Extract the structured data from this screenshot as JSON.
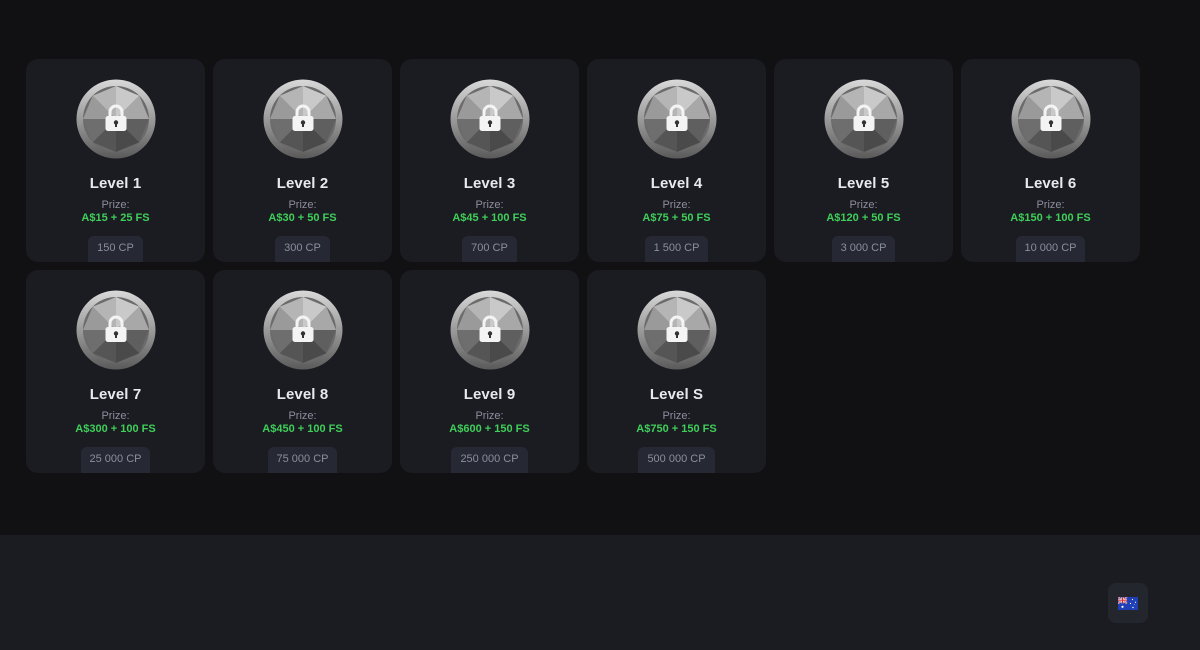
{
  "levels": [
    {
      "title": "Level 1",
      "prize_label": "Prize:",
      "prize": "A$15 + 25 FS",
      "points": "150 CP",
      "icon": "lock-icon"
    },
    {
      "title": "Level 2",
      "prize_label": "Prize:",
      "prize": "A$30 + 50 FS",
      "points": "300 CP",
      "icon": "lock-icon"
    },
    {
      "title": "Level 3",
      "prize_label": "Prize:",
      "prize": "A$45 + 100 FS",
      "points": "700 CP",
      "icon": "lock-icon"
    },
    {
      "title": "Level 4",
      "prize_label": "Prize:",
      "prize": "A$75 + 50 FS",
      "points": "1 500 CP",
      "icon": "lock-icon"
    },
    {
      "title": "Level 5",
      "prize_label": "Prize:",
      "prize": "A$120 + 50 FS",
      "points": "3 000 CP",
      "icon": "lock-icon"
    },
    {
      "title": "Level 6",
      "prize_label": "Prize:",
      "prize": "A$150 + 100 FS",
      "points": "10 000 CP",
      "icon": "lock-icon"
    },
    {
      "title": "Level 7",
      "prize_label": "Prize:",
      "prize": "A$300 + 100 FS",
      "points": "25 000 CP",
      "icon": "lock-icon"
    },
    {
      "title": "Level 8",
      "prize_label": "Prize:",
      "prize": "A$450 + 100 FS",
      "points": "75 000 CP",
      "icon": "lock-icon"
    },
    {
      "title": "Level 9",
      "prize_label": "Prize:",
      "prize": "A$600 + 150 FS",
      "points": "250 000 CP",
      "icon": "lock-icon"
    },
    {
      "title": "Level S",
      "prize_label": "Prize:",
      "prize": "A$750 + 150 FS",
      "points": "500 000 CP",
      "icon": "lock-icon"
    }
  ],
  "footer": {
    "language_icon": "australia-flag-icon"
  },
  "colors": {
    "background": "#111113",
    "card": "#1b1c21",
    "prize_green": "#3fce5a",
    "muted_text": "#8b8e9e"
  }
}
